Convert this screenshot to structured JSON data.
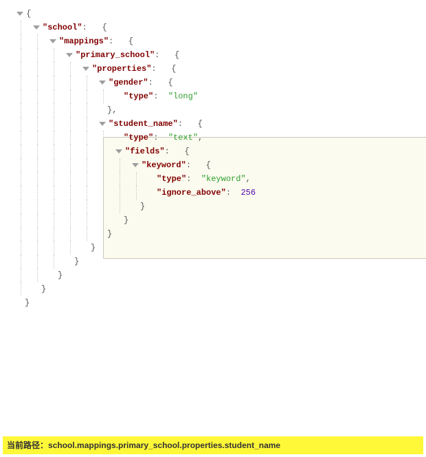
{
  "keys": {
    "school": "school",
    "mappings": "mappings",
    "primary_school": "primary_school",
    "properties": "properties",
    "gender": "gender",
    "type": "type",
    "student_name": "student_name",
    "fields": "fields",
    "keyword": "keyword",
    "ignore_above": "ignore_above"
  },
  "values": {
    "long": "long",
    "text": "text",
    "keyword": "keyword",
    "ignore_above": 256
  },
  "symbols": {
    "open_brace": "{",
    "close_brace": "}",
    "close_brace_comma": "},",
    "colon": ":",
    "comma": ",",
    "quote": "\""
  },
  "status": {
    "label": "当前路径：",
    "path": "school.mappings.primary_school.properties.student_name"
  },
  "json_structure": {
    "school": {
      "mappings": {
        "primary_school": {
          "properties": {
            "gender": {
              "type": "long"
            },
            "student_name": {
              "type": "text",
              "fields": {
                "keyword": {
                  "type": "keyword",
                  "ignore_above": 256
                }
              }
            }
          }
        }
      }
    }
  }
}
